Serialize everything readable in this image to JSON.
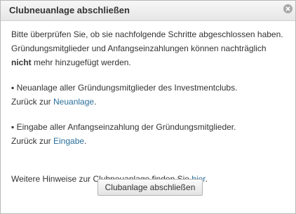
{
  "dialog": {
    "title": "Clubneuanlage abschließen",
    "intro_part1": "Bitte überprüfen Sie, ob sie nachfolgende Schritte abgeschlossen haben. Gründungsmitglieder und Anfangseinzahlungen können nachträglich ",
    "intro_bold": "nicht",
    "intro_part2": " mehr hinzugefügt werden.",
    "items": [
      {
        "bullet": "▪",
        "text": " Neuanlage aller Gründungsmitglieder des Investmentclubs.",
        "back_prefix": "Zurück zur ",
        "link": "Neuanlage",
        "suffix": "."
      },
      {
        "bullet": "▪",
        "text": " Eingabe aller Anfangseinzahlung der Gründungsmitglieder.",
        "back_prefix": "Zurück zur ",
        "link": "Eingabe",
        "suffix": "."
      }
    ],
    "hint_prefix": "Weitere Hinweise zur Clubneuanlage finden Sie ",
    "hint_link": "hier",
    "hint_suffix": ".",
    "button_label": "Clubanlage abschließen",
    "close_icon": "close-icon",
    "link_color": "#2b6f9a"
  }
}
